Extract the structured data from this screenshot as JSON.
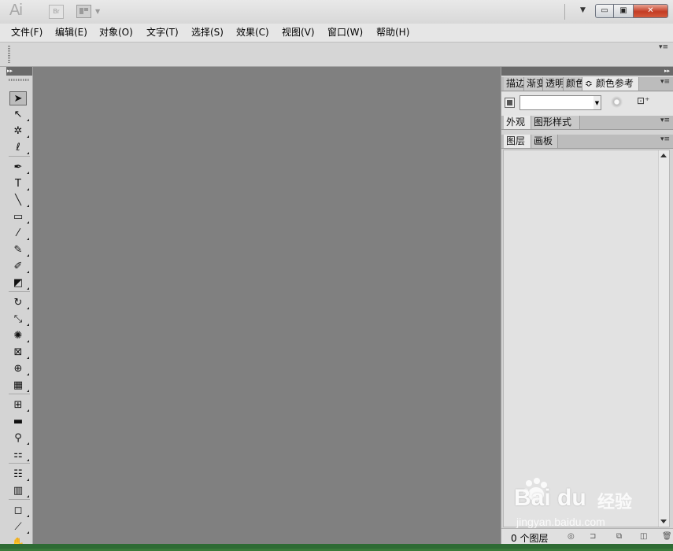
{
  "titlebar": {
    "app_logo": "Ai",
    "bridge_label": "Br",
    "workspace_icon": "workspace-switcher-icon",
    "window_controls": {
      "minimize": "▭",
      "maximize": "▣",
      "close": "✕"
    }
  },
  "menubar": {
    "items": [
      {
        "label": "文件(F)"
      },
      {
        "label": "编辑(E)"
      },
      {
        "label": "对象(O)"
      },
      {
        "label": "文字(T)"
      },
      {
        "label": "选择(S)"
      },
      {
        "label": "效果(C)"
      },
      {
        "label": "视图(V)"
      },
      {
        "label": "窗口(W)"
      },
      {
        "label": "帮助(H)"
      }
    ]
  },
  "toolbox": {
    "collapse_glyph": "▸▸",
    "tools": [
      {
        "name": "selection-tool-icon",
        "glyph": "➤",
        "selected": true
      },
      {
        "name": "direct-selection-tool-icon",
        "glyph": "↖"
      },
      {
        "name": "magic-wand-tool-icon",
        "glyph": "✲"
      },
      {
        "name": "lasso-tool-icon",
        "glyph": "ℓ"
      },
      {
        "name": "pen-tool-icon",
        "glyph": "✒"
      },
      {
        "name": "type-tool-icon",
        "glyph": "T"
      },
      {
        "name": "line-segment-tool-icon",
        "glyph": "╲"
      },
      {
        "name": "rectangle-tool-icon",
        "glyph": "▭"
      },
      {
        "name": "paintbrush-tool-icon",
        "glyph": "⁄"
      },
      {
        "name": "pencil-tool-icon",
        "glyph": "✎"
      },
      {
        "name": "blob-brush-tool-icon",
        "glyph": "✐"
      },
      {
        "name": "eraser-tool-icon",
        "glyph": "◩"
      },
      {
        "name": "rotate-tool-icon",
        "glyph": "↻"
      },
      {
        "name": "scale-tool-icon",
        "glyph": "⤡"
      },
      {
        "name": "warp-tool-icon",
        "glyph": "✺"
      },
      {
        "name": "free-transform-tool-icon",
        "glyph": "⊠"
      },
      {
        "name": "shape-builder-tool-icon",
        "glyph": "⊕"
      },
      {
        "name": "perspective-grid-tool-icon",
        "glyph": "▦"
      },
      {
        "name": "mesh-tool-icon",
        "glyph": "⊞"
      },
      {
        "name": "gradient-tool-icon",
        "glyph": "▬"
      },
      {
        "name": "eyedropper-tool-icon",
        "glyph": "⚲"
      },
      {
        "name": "blend-tool-icon",
        "glyph": "⚏"
      },
      {
        "name": "symbol-sprayer-tool-icon",
        "glyph": "☷"
      },
      {
        "name": "column-graph-tool-icon",
        "glyph": "▥"
      },
      {
        "name": "artboard-tool-icon",
        "glyph": "◻"
      },
      {
        "name": "slice-tool-icon",
        "glyph": "⟋"
      },
      {
        "name": "hand-tool-icon",
        "glyph": "✋"
      }
    ]
  },
  "panels": {
    "dock_collapse_glyph": "▸▸",
    "top_group": {
      "tabs": [
        {
          "label": "描边"
        },
        {
          "label": "渐变"
        },
        {
          "label": "透明"
        },
        {
          "label": "颜色"
        },
        {
          "label": "颜色参考"
        }
      ],
      "active_prefix": "≎"
    },
    "appearance_group": {
      "tabs": [
        {
          "label": "外观"
        },
        {
          "label": "图形样式"
        }
      ]
    },
    "layers_group": {
      "tabs": [
        {
          "label": "图层"
        },
        {
          "label": "画板"
        }
      ],
      "layer_count": "0 个图层"
    },
    "panel_menu_glyph": "▾≡"
  },
  "watermark": {
    "brand": "Bai  du",
    "brand_cn": "经验",
    "url": "jingyan.baidu.com"
  },
  "colors": {
    "canvas": "#808080",
    "ui_bg": "#d4d4d4",
    "dark_header": "#6a6a6a",
    "close_button": "#c43c24"
  }
}
